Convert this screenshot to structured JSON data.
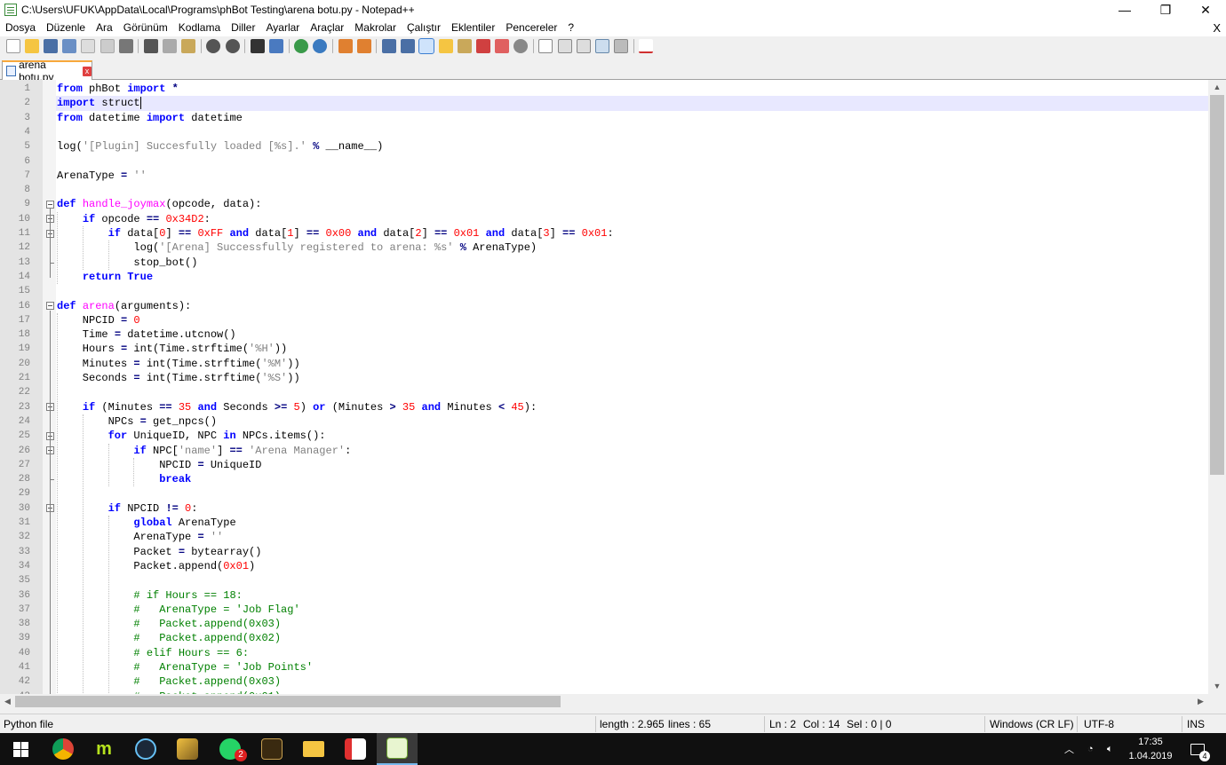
{
  "window": {
    "title": "C:\\Users\\UFUK\\AppData\\Local\\Programs\\phBot Testing\\arena botu.py - Notepad++",
    "minimize": "—",
    "maximize": "❐",
    "close": "✕"
  },
  "menu": {
    "items": [
      "Dosya",
      "Düzenle",
      "Ara",
      "Görünüm",
      "Kodlama",
      "Diller",
      "Ayarlar",
      "Araçlar",
      "Makrolar",
      "Çalıştır",
      "Eklentiler",
      "Pencereler",
      "?"
    ],
    "close": "X"
  },
  "toolbar": {
    "icons": [
      "new-file-icon",
      "open-file-icon",
      "save-icon",
      "save-all-icon",
      "close-icon",
      "close-all-icon",
      "print-icon",
      "cut-icon",
      "copy-icon",
      "paste-icon",
      "undo-icon",
      "redo-icon",
      "find-icon",
      "replace-icon",
      "zoom-in-icon",
      "zoom-out-icon",
      "sync-vertical-icon",
      "sync-horizontal-icon",
      "word-wrap-icon",
      "show-all-chars-icon",
      "indent-guide-icon",
      "user-language-icon",
      "doc-map-icon",
      "function-list-icon",
      "folder-workspace-icon",
      "monitoring-icon",
      "record-macro-icon",
      "stop-macro-icon",
      "play-macro-icon",
      "run-macro-multiple-icon",
      "save-macro-icon",
      "spell-check-icon"
    ]
  },
  "tab": {
    "label": "arena botu.py",
    "close": "x"
  },
  "editor": {
    "current_line": 2
  },
  "statusbar": {
    "filetype": "Python file",
    "length": "length : 2.965",
    "lines": "lines : 65",
    "ln": "Ln : 2",
    "col": "Col : 14",
    "sel": "Sel : 0 | 0",
    "eol": "Windows (CR LF)",
    "encoding": "UTF-8",
    "mode": "INS"
  },
  "taskbar": {
    "apps": [
      "windows-start-icon",
      "chrome-icon",
      "m-app-icon",
      "steam-icon",
      "pen-app-icon",
      "whatsapp-icon",
      "game-app-icon",
      "file-explorer-icon",
      "px-app-icon",
      "notepadpp-icon"
    ],
    "whatsapp_badge": "2",
    "time": "17:35",
    "date": "1.04.2019",
    "notification_count": "4"
  }
}
